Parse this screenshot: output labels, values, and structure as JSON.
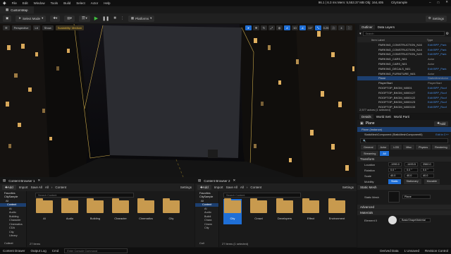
{
  "menu": {
    "items": [
      "File",
      "Edit",
      "Window",
      "Tools",
      "Build",
      "Select",
      "Actor",
      "Help"
    ],
    "stats": "96.1 | 6.3 ms  Mem: 5,553.37 MB  Obj: 164,405",
    "project": "CitySample"
  },
  "tab": {
    "label": "CustomMap"
  },
  "toolbar": {
    "select_mode": "Select Mode",
    "platforms": "Platforms",
    "settings": "Settings"
  },
  "viewport": {
    "perspective": "Perspective",
    "lit": "Lit",
    "show": "Show",
    "scalability": "Scalability: Medium",
    "snap_value": "10",
    "angle_value": "10°",
    "scale_value": "0.25",
    "cam_speed": "4"
  },
  "outliner": {
    "tab": "Outliner",
    "layers": "Data Layers",
    "search_placeholder": "Search",
    "col_label": "Item Label",
    "col_type": "Type",
    "rows": [
      {
        "name": "PARKING_CONSTRUCTION_N16",
        "type": "Edit BPP_Park"
      },
      {
        "name": "PARKING_CONSTRUCTION_N14",
        "type": "Edit BPP_Park"
      },
      {
        "name": "PARKING_CONSTRUCTION_N15",
        "type": "Edit BPP_Park"
      },
      {
        "name": "PARKING_CARS_N01",
        "type": "Actor"
      },
      {
        "name": "PARKING_CARS_N01",
        "type": "Actor"
      },
      {
        "name": "PARKING_DECALS_N01",
        "type": "Edit BPP_Park"
      },
      {
        "name": "PARKING_FURNITURE_N01",
        "type": "Actor"
      },
      {
        "name": "Plane",
        "type": "StaticMeshActor"
      },
      {
        "name": "PlayerStart",
        "type": "PlayerStart"
      },
      {
        "name": "ROOFTOP_BKGM_N0001",
        "type": "Edit BPP_Roof"
      },
      {
        "name": "ROOFTOP_BKGM_N000127",
        "type": "Edit BPP_Roof"
      },
      {
        "name": "ROOFTOP_BKGM_N000122",
        "type": "Edit BPP_Roof"
      },
      {
        "name": "ROOFTOP_BKGM_N000123",
        "type": "Edit BPP_Roof"
      },
      {
        "name": "ROOFTOP_BKGM_N000133",
        "type": "Edit BPP_Roof"
      }
    ],
    "count": "2,577 actors (1 selected)"
  },
  "details": {
    "tab": "Details",
    "world1": "World Sett",
    "world2": "World Parti",
    "object": "Plane",
    "add": "Add",
    "instance": "Plane (Instance)",
    "component": "StaticMeshComponent (StaticMeshComponent0)",
    "edit_btn": "Edit in C++",
    "filters": [
      "General",
      "Actor",
      "LOD",
      "Misc",
      "Physics",
      "Rendering",
      "Streaming",
      "All"
    ],
    "transform": "Transform",
    "location": "Location",
    "rotation": "Rotation",
    "scale": "Scale",
    "mobility": "Mobility",
    "loc": [
      "-1990.0",
      "-1493.5",
      "2560.0"
    ],
    "rot": [
      "0.0 °",
      "0.0 °",
      "0.0 °"
    ],
    "scl": [
      "40.0",
      "40.0",
      "40.0"
    ],
    "mob": [
      "Static",
      "Stationary",
      "Movable"
    ],
    "static_mesh": "Static Mesh",
    "mesh_label": "Static Mesh",
    "mesh_value": "Plane",
    "advanced": "Advanced",
    "materials": "Materials",
    "element": "Element 0",
    "mat_value": "BasicShapeMaterial"
  },
  "cb1": {
    "tab": "Content Browser 1",
    "add": "Add",
    "import": "Import",
    "save": "Save All",
    "path": [
      "All",
      "Content"
    ],
    "settings": "Settings",
    "favorites": "Favorites",
    "root": "CitySample",
    "search": "Search Content",
    "tree": [
      "All",
      "Content",
      "AI",
      "Audio",
      "Building",
      "Character",
      "Cinematics",
      "CDA",
      "City",
      "Library"
    ],
    "folders": [
      "AI",
      "Audio",
      "Building",
      "Character",
      "Cinematics",
      "City"
    ],
    "count": "27 items",
    "collections": "Collecti"
  },
  "cb2": {
    "tab": "Content Browser 2",
    "add": "Add",
    "import": "Import",
    "save": "Save All",
    "path": [
      "All",
      "Content"
    ],
    "settings": "Settings",
    "favorites": "Favorites",
    "root": "CitySample",
    "search": "Search Content",
    "tree": [
      "All",
      "Content",
      "AI",
      "Audio",
      "Buildi",
      "Chara",
      "Cinem",
      "City"
    ],
    "folders": [
      "City",
      "Crowd",
      "Developers",
      "Effect",
      "Environment"
    ],
    "count": "27 items (1 selected)",
    "collections": "Coll"
  },
  "status": {
    "drawer": "Content Drawer",
    "output": "Output Log",
    "cmd": "Cmd",
    "console_placeholder": "Enter Console Command",
    "derived": "Derived Data",
    "unsaved": "1 Unsaved",
    "revision": "Revision Control"
  }
}
